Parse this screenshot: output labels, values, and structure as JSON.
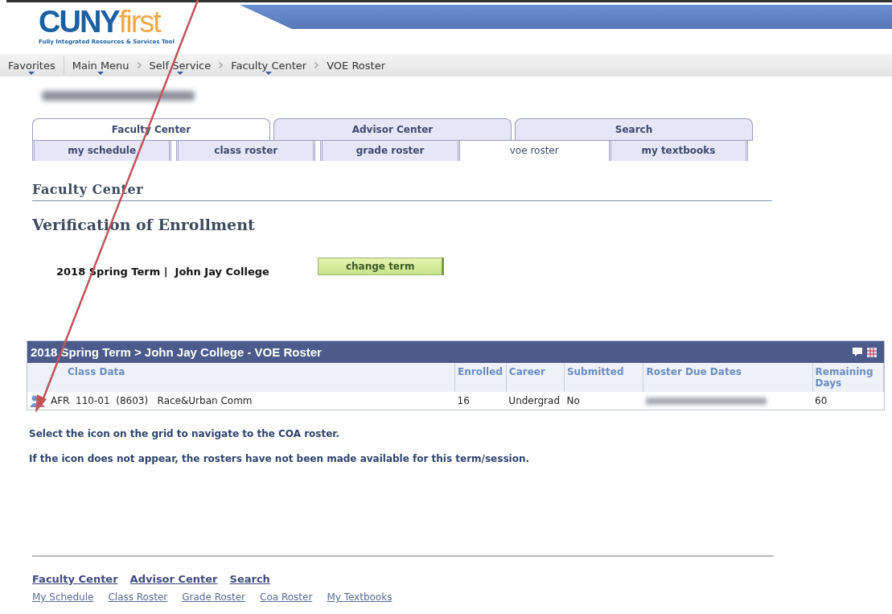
{
  "logo": {
    "name": "CUNY",
    "accent": "first",
    "tagline": "Fully Integrated Resources & Services Tool"
  },
  "breadcrumbs": [
    {
      "label": "Favorites",
      "menu": true
    },
    {
      "label": "Main Menu",
      "menu": true
    },
    {
      "label": "Self Service",
      "menu": true
    },
    {
      "label": "Faculty Center",
      "menu": true
    },
    {
      "label": "VOE Roster",
      "menu": false
    }
  ],
  "tabs": [
    {
      "label": "Faculty Center",
      "selected": true
    },
    {
      "label": "Advisor Center",
      "selected": false
    },
    {
      "label": "Search",
      "selected": false
    }
  ],
  "subtabs": [
    {
      "label": "my schedule",
      "selected": false
    },
    {
      "label": "class roster",
      "selected": false
    },
    {
      "label": "grade roster",
      "selected": false
    },
    {
      "label": "voe roster",
      "selected": true
    },
    {
      "label": "my textbooks",
      "selected": false
    }
  ],
  "section_title": "Faculty Center",
  "page_title": "Verification of Enrollment",
  "term": {
    "text": "2018 Spring Term |  John Jay College",
    "button": "change term"
  },
  "grid": {
    "title": "2018 Spring Term > John Jay College - VOE Roster",
    "columns": [
      "Class Data",
      "Enrolled",
      "Career",
      "Submitted",
      "Roster Due Dates",
      "Remaining Days"
    ],
    "rows": [
      {
        "class_data": "AFR  110-01  (8603)   Race&Urban Comm",
        "enrolled": "16",
        "career": "Undergrad",
        "submitted": "No",
        "remaining_days": "60"
      }
    ]
  },
  "notes": [
    "Select the icon on the grid to navigate to the COA roster.",
    "If the icon does not appear, the rosters have not been made available for this term/session."
  ],
  "footer": {
    "primary_links": [
      "Faculty Center",
      "Advisor Center",
      "Search"
    ],
    "secondary_links": [
      "My Schedule",
      "Class Roster",
      "Grade Roster",
      "Coa Roster",
      "My Textbooks"
    ]
  }
}
